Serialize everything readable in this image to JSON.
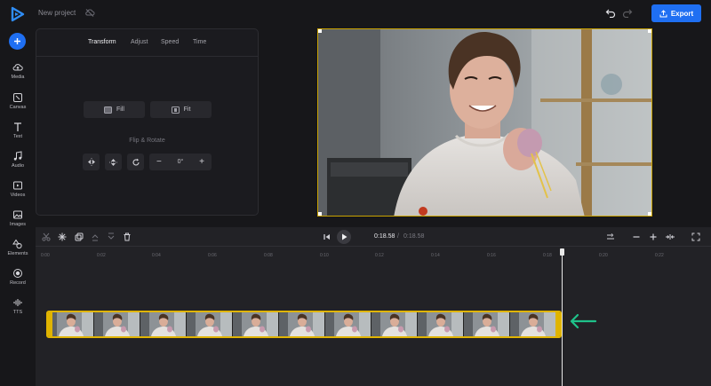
{
  "header": {
    "project_title": "New project",
    "export_label": "Export",
    "accent_color": "#1f6ff2"
  },
  "rail": {
    "items": [
      {
        "label": "Media",
        "icon": "cloud-upload-icon"
      },
      {
        "label": "Canvas",
        "icon": "canvas-icon"
      },
      {
        "label": "Text",
        "icon": "text-icon"
      },
      {
        "label": "Audio",
        "icon": "music-note-icon"
      },
      {
        "label": "Videos",
        "icon": "video-icon"
      },
      {
        "label": "Images",
        "icon": "image-icon"
      },
      {
        "label": "Elements",
        "icon": "shapes-icon"
      },
      {
        "label": "Record",
        "icon": "record-icon"
      },
      {
        "label": "TTS",
        "icon": "waveform-icon"
      }
    ]
  },
  "panel": {
    "tabs": [
      "Transform",
      "Adjust",
      "Speed",
      "Time"
    ],
    "active_tab": "Transform",
    "fill_label": "Fill",
    "fit_label": "Fit",
    "flip_rotate_label": "Flip & Rotate",
    "rotation_value": "0°"
  },
  "timeline": {
    "current_time": "0:18.58",
    "separator": "/",
    "total_time": "0:18.58",
    "ruler_ticks": [
      "0:00",
      "0:02",
      "0:04",
      "0:06",
      "0:08",
      "0:10",
      "0:12",
      "0:14",
      "0:16",
      "0:18",
      "0:20",
      "0:22"
    ],
    "clip_frame_count": 11,
    "clip_color": "#e0b400",
    "annotation_arrow_color": "#1fc28a"
  }
}
